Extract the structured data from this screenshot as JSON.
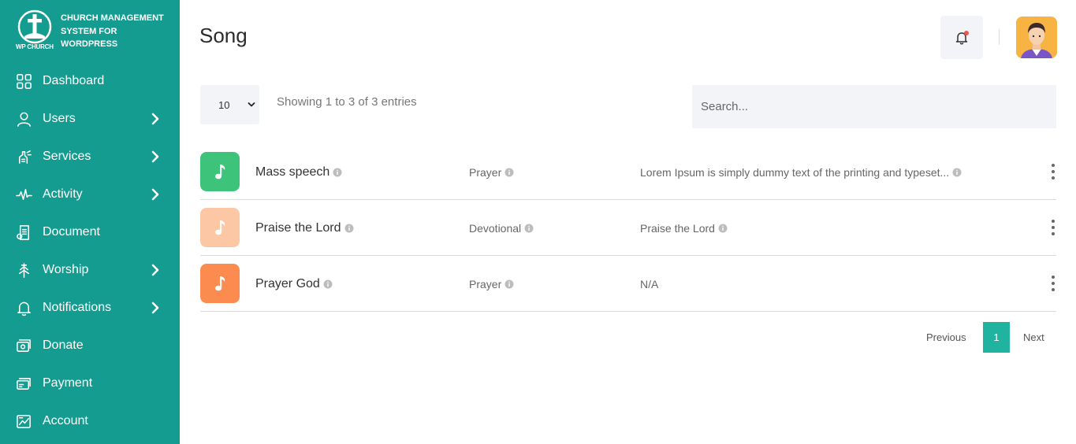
{
  "brand": {
    "title": "Church Management System for Wordpress",
    "subtitle": "WP CHURCH"
  },
  "sidebar": {
    "items": [
      {
        "label": "Dashboard",
        "icon": "dashboard-grid-icon",
        "has_arrow": false
      },
      {
        "label": "Users",
        "icon": "user-icon",
        "has_arrow": true
      },
      {
        "label": "Services",
        "icon": "services-icon",
        "has_arrow": true
      },
      {
        "label": "Activity",
        "icon": "activity-pulse-icon",
        "has_arrow": true
      },
      {
        "label": "Document",
        "icon": "document-icon",
        "has_arrow": false
      },
      {
        "label": "Worship",
        "icon": "worship-icon",
        "has_arrow": true
      },
      {
        "label": "Notifications",
        "icon": "bell-icon",
        "has_arrow": true
      },
      {
        "label": "Donate",
        "icon": "donate-icon",
        "has_arrow": false
      },
      {
        "label": "Payment",
        "icon": "payment-icon",
        "has_arrow": false
      },
      {
        "label": "Account",
        "icon": "account-icon",
        "has_arrow": false
      }
    ]
  },
  "header": {
    "title": "Song"
  },
  "controls": {
    "page_size": "10",
    "entries_info": "Showing 1 to 3 of 3 entries",
    "search_placeholder": "Search..."
  },
  "songs": [
    {
      "name": "Mass speech",
      "category": "Prayer",
      "description": "Lorem Ipsum is simply dummy text of the printing and typeset...",
      "desc_has_info": true,
      "icon_color": "#3ec47a"
    },
    {
      "name": "Praise the Lord",
      "category": "Devotional",
      "description": "Praise the Lord",
      "desc_has_info": true,
      "icon_color": "#fcc7a4"
    },
    {
      "name": "Prayer God",
      "category": "Prayer",
      "description": "N/A",
      "desc_has_info": false,
      "icon_color": "#fb8b4f"
    }
  ],
  "pagination": {
    "previous": "Previous",
    "current": "1",
    "next": "Next"
  },
  "colors": {
    "sidebar_bg": "#149c90",
    "accent": "#20b39f",
    "notification_dot": "#ef5350"
  }
}
